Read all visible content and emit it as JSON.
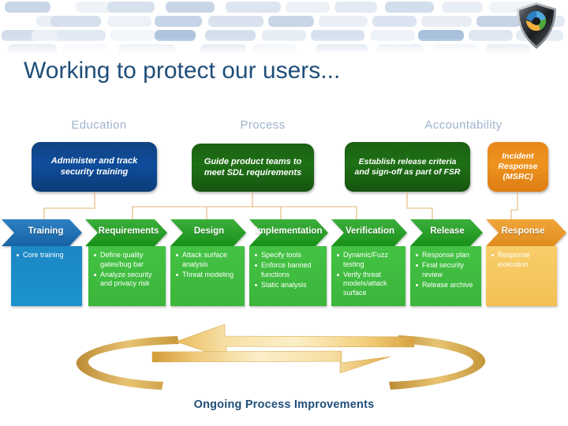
{
  "header": {
    "logo_icon": "security-shield-icon",
    "title": "Working to protect our users..."
  },
  "categories": [
    {
      "id": "education",
      "label": "Education"
    },
    {
      "id": "process",
      "label": "Process"
    },
    {
      "id": "accountability",
      "label": "Accountability"
    }
  ],
  "callouts": [
    {
      "id": "education",
      "text": "Administer and track security training",
      "color": "#0F4D9C"
    },
    {
      "id": "process",
      "text": "Guide product teams to meet SDL requirements",
      "color": "#1E7015"
    },
    {
      "id": "release",
      "text": "Establish release criteria and sign-off as part of FSR",
      "color": "#1E7015"
    },
    {
      "id": "incident",
      "text": "Incident Response (MSRC)",
      "color": "#EE931F"
    }
  ],
  "sdl_phases": [
    {
      "name": "Training",
      "color": "#1C8BC9",
      "items": [
        "Core training"
      ]
    },
    {
      "name": "Requirements",
      "color": "#3DBB3D",
      "items": [
        "Define quality gates/bug bar",
        "Analyze security and privacy risk"
      ]
    },
    {
      "name": "Design",
      "color": "#3DBB3D",
      "items": [
        "Attack surface analysis",
        "Threat modeling"
      ]
    },
    {
      "name": "Implementation",
      "color": "#3DBB3D",
      "items": [
        "Specify tools",
        "Enforce banned functions",
        "Static analysis"
      ]
    },
    {
      "name": "Verification",
      "color": "#3DBB3D",
      "items": [
        "Dynamic/Fuzz testing",
        "Verify threat models/attack surface"
      ]
    },
    {
      "name": "Release",
      "color": "#3DBB3D",
      "items": [
        "Response plan",
        "Final security review",
        "Release archive"
      ]
    },
    {
      "name": "Response",
      "color": "#F5C453",
      "items": [
        "Response execution"
      ]
    }
  ],
  "cycle": {
    "label": "Ongoing Process Improvements",
    "arrow_color": "#F0C36A"
  },
  "colors": {
    "title": "#1F4E79",
    "category_heading": "#9FB4CE",
    "connector": "#E0B070"
  }
}
